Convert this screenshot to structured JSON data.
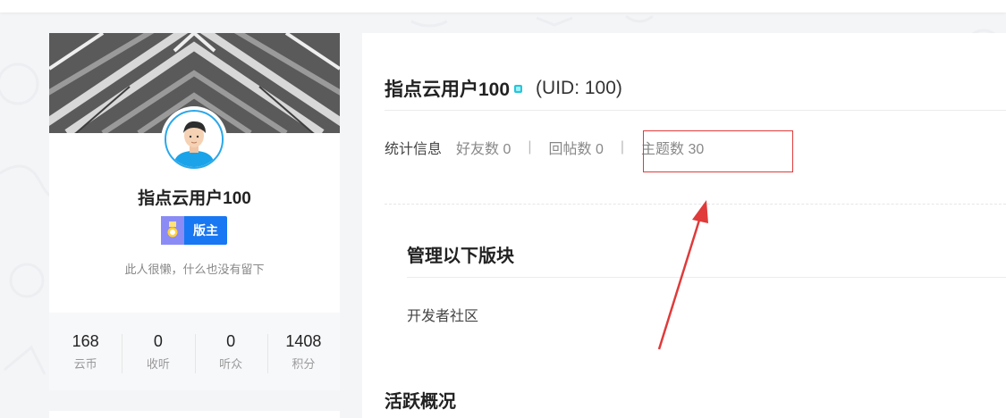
{
  "profile": {
    "name": "指点云用户100",
    "role_label": "版主",
    "bio": "此人很懒，什么也没有留下",
    "stats": [
      {
        "value": "168",
        "label": "云币"
      },
      {
        "value": "0",
        "label": "收听"
      },
      {
        "value": "0",
        "label": "听众"
      },
      {
        "value": "1408",
        "label": "积分"
      }
    ]
  },
  "main": {
    "username": "指点云用户100",
    "uid": "(UID: 100)",
    "stats_heading": "统计信息",
    "stat_friends": "好友数 0",
    "stat_replies": "回帖数 0",
    "stat_topics": "主题数 30",
    "separator": "|",
    "manage_title": "管理以下版块",
    "forum_item": "开发者社区",
    "activity_title": "活跃概况"
  },
  "colors": {
    "accent_blue": "#1877f2",
    "annotation_red": "#e03a3a",
    "avatar_ring": "#2aa7ea"
  },
  "icons": {
    "avatar": "user-avatar-icon",
    "medal": "medal-icon",
    "gem": "gem-icon",
    "annotation_arrow": "red-arrow-icon"
  }
}
